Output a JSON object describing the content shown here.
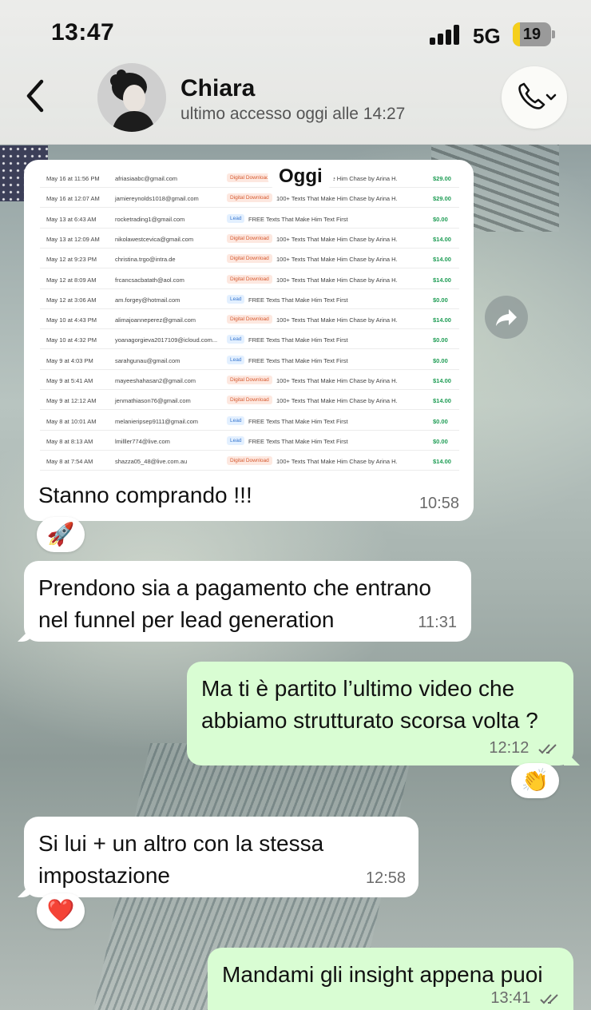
{
  "status_bar": {
    "time": "13:47",
    "network": "5G",
    "battery": "19",
    "battery_level_pct": 19
  },
  "header": {
    "contact_name": "Chiara",
    "last_seen": "ultimo accesso oggi alle 14:27",
    "back_icon": "chevron-left-icon",
    "call_icon": "phone-icon"
  },
  "day_chip": "Oggi",
  "image_message": {
    "rows": [
      {
        "date": "May 16 at 11:56 PM",
        "email": "afriasiaabc@gmail.com",
        "tag": "Digital Download",
        "product": "100+ Texts That Make Him Chase by Arina H.",
        "price": "$29.00"
      },
      {
        "date": "May 16 at 12:07 AM",
        "email": "jamiereynolds1018@gmail.com",
        "tag": "Digital Download",
        "product": "100+ Texts That Make Him Chase by Arina H.",
        "price": "$29.00"
      },
      {
        "date": "May 13 at 6:43 AM",
        "email": "rocketrading1@gmail.com",
        "tag": "Lead",
        "product": "FREE Texts That Make Him Text First",
        "price": "$0.00"
      },
      {
        "date": "May 13 at 12:09 AM",
        "email": "nikolawestcevica@gmail.com",
        "tag": "Digital Download",
        "product": "100+ Texts That Make Him Chase by Arina H.",
        "price": "$14.00"
      },
      {
        "date": "May 12 at 9:23 PM",
        "email": "christina.trgo@intra.de",
        "tag": "Digital Download",
        "product": "100+ Texts That Make Him Chase by Arina H.",
        "price": "$14.00"
      },
      {
        "date": "May 12 at 8:09 AM",
        "email": "frcancsacbatath@aol.com",
        "tag": "Digital Download",
        "product": "100+ Texts That Make Him Chase by Arina H.",
        "price": "$14.00"
      },
      {
        "date": "May 12 at 3:06 AM",
        "email": "am.forgey@hotmail.com",
        "tag": "Lead",
        "product": "FREE Texts That Make Him Text First",
        "price": "$0.00"
      },
      {
        "date": "May 10 at 4:43 PM",
        "email": "alimajoanneperez@gmail.com",
        "tag": "Digital Download",
        "product": "100+ Texts That Make Him Chase by Arina H.",
        "price": "$14.00"
      },
      {
        "date": "May 10 at 4:32 PM",
        "email": "yoanagorgieva2017109@icloud.com...",
        "tag": "Lead",
        "product": "FREE Texts That Make Him Text First",
        "price": "$0.00"
      },
      {
        "date": "May 9 at 4:03 PM",
        "email": "sarahgunau@gmail.com",
        "tag": "Lead",
        "product": "FREE Texts That Make Him Text First",
        "price": "$0.00"
      },
      {
        "date": "May 9 at 5:41 AM",
        "email": "mayeeshahasan2@gmail.com",
        "tag": "Digital Download",
        "product": "100+ Texts That Make Him Chase by Arina H.",
        "price": "$14.00"
      },
      {
        "date": "May 9 at 12:12 AM",
        "email": "jenmathiason76@gmail.com",
        "tag": "Digital Download",
        "product": "100+ Texts That Make Him Chase by Arina H.",
        "price": "$14.00"
      },
      {
        "date": "May 8 at 10:01 AM",
        "email": "melanieripsep9111@gmail.com",
        "tag": "Lead",
        "product": "FREE Texts That Make Him Text First",
        "price": "$0.00"
      },
      {
        "date": "May 8 at 8:13 AM",
        "email": "lmilller774@live.com",
        "tag": "Lead",
        "product": "FREE Texts That Make Him Text First",
        "price": "$0.00"
      },
      {
        "date": "May 8 at 7:54 AM",
        "email": "shazza05_48@live.com.au",
        "tag": "Digital Download",
        "product": "100+ Texts That Make Him Chase by Arina H.",
        "price": "$14.00"
      }
    ],
    "caption": "Stanno comprando !!!",
    "time": "10:58",
    "reaction": "🚀"
  },
  "messages": {
    "m2": {
      "text_line1": "Prendono sia a pagamento che entrano",
      "text_line2": "nel funnel per lead generation",
      "time": "11:31"
    },
    "m3": {
      "text_line1": "Ma ti è partito l’ultimo video che",
      "text_line2": "abbiamo strutturato scorsa volta ?",
      "time": "12:12",
      "reaction": "👏"
    },
    "m4": {
      "text_line1": "Si lui + un altro con la stessa",
      "text_line2": "impostazione",
      "time": "12:58",
      "reaction": "❤️"
    },
    "m5": {
      "text_line1": "Mandami gli insight appena puoi",
      "time": "13:41"
    }
  },
  "colors": {
    "outgoing_bubble": "#d9fdd3",
    "incoming_bubble": "#ffffff",
    "price_green": "#1f9d55",
    "read_ticks": "#6b6b6b"
  }
}
